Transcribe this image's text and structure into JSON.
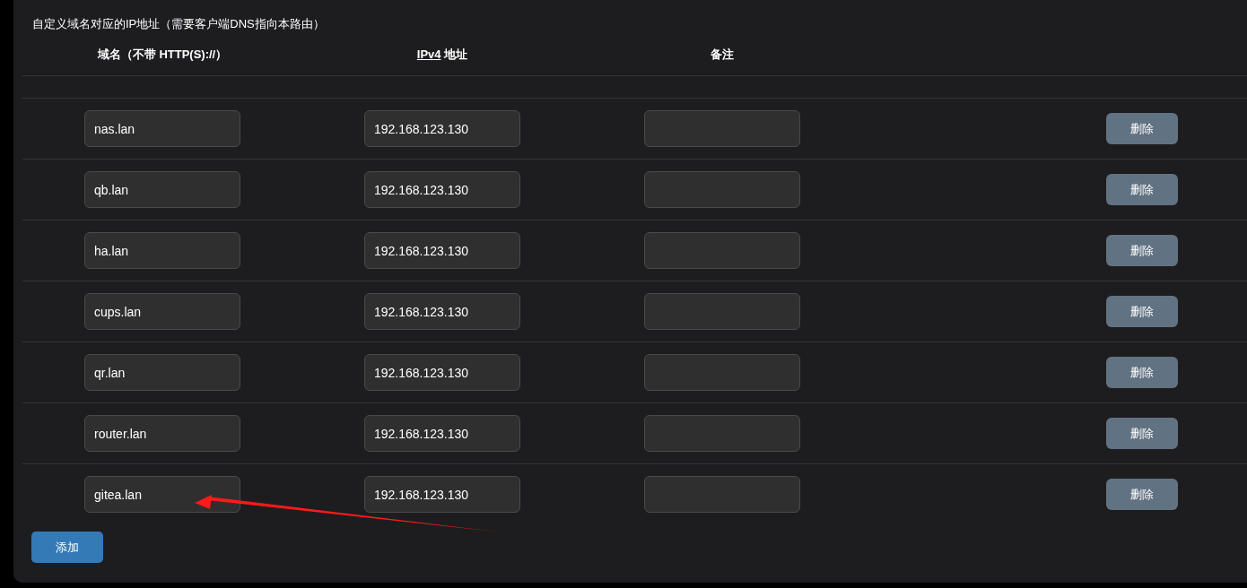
{
  "description": "自定义域名对应的IP地址（需要客户端DNS指向本路由）",
  "columns": [
    {
      "label": "域名（不带 HTTP(S)://）"
    },
    {
      "abbr": "IPv4",
      "label": " 地址"
    },
    {
      "label": "备注"
    }
  ],
  "rows": [
    {
      "domain": "nas.lan",
      "ip": "192.168.123.130",
      "delete": "删除"
    },
    {
      "domain": "qb.lan",
      "ip": "192.168.123.130",
      "delete": "删除"
    },
    {
      "domain": "ha.lan",
      "ip": "192.168.123.130",
      "delete": "删除"
    },
    {
      "domain": "cups.lan",
      "ip": "192.168.123.130",
      "delete": "删除"
    },
    {
      "domain": "qr.lan",
      "ip": "192.168.123.130",
      "delete": "删除"
    },
    {
      "domain": "router.lan",
      "ip": "192.168.123.130",
      "delete": "删除"
    },
    {
      "domain": "gitea.lan",
      "ip": "192.168.123.130",
      "delete": "删除"
    }
  ],
  "add_button": "添加",
  "annotation": {
    "kind": "arrow",
    "color": "#ff1a1a"
  }
}
